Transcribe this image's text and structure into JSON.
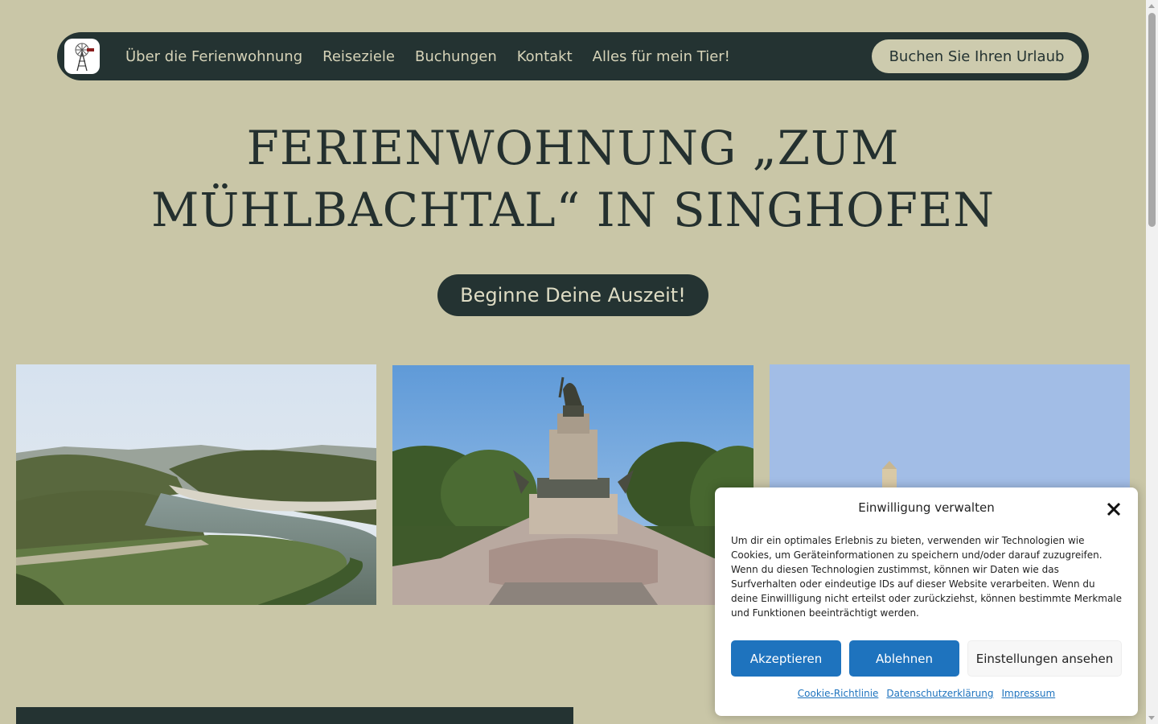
{
  "nav": {
    "logo_icon": "windmill-icon",
    "links": [
      {
        "label": "Über die Ferienwohnung"
      },
      {
        "label": "Reiseziele"
      },
      {
        "label": "Buchungen"
      },
      {
        "label": "Kontakt"
      },
      {
        "label": "Alles für mein Tier!"
      }
    ],
    "book_label": "Buchen Sie Ihren Urlaub"
  },
  "hero": {
    "title_line1": "FERIENWOHNUNG „ZUM",
    "title_line2": "MÜHLBACHTAL“ IN SINGHOFEN",
    "cta_label": "Beginne Deine Auszeit!"
  },
  "cookie": {
    "title": "Einwilligung verwalten",
    "close_icon": "close-icon",
    "text": "Um dir ein optimales Erlebnis zu bieten, verwenden wir Technologien wie Cookies, um Geräteinformationen zu speichern und/oder darauf zuzugreifen. Wenn du diesen Technologien zustimmst, können wir Daten wie das Surfverhalten oder eindeutige IDs auf dieser Website verarbeiten. Wenn du deine Einwillligung nicht erteilst oder zurückziehst, können bestimmte Merkmale und Funktionen beeinträchtigt werden.",
    "accept_label": "Akzeptieren",
    "deny_label": "Ablehnen",
    "settings_label": "Einstellungen ansehen",
    "links": [
      {
        "label": "Cookie-Richtlinie"
      },
      {
        "label": "Datenschutzerklärung"
      },
      {
        "label": "Impressum"
      }
    ]
  },
  "colors": {
    "background": "#c9c6a7",
    "dark": "#243332",
    "accent_blue": "#1e73be"
  }
}
